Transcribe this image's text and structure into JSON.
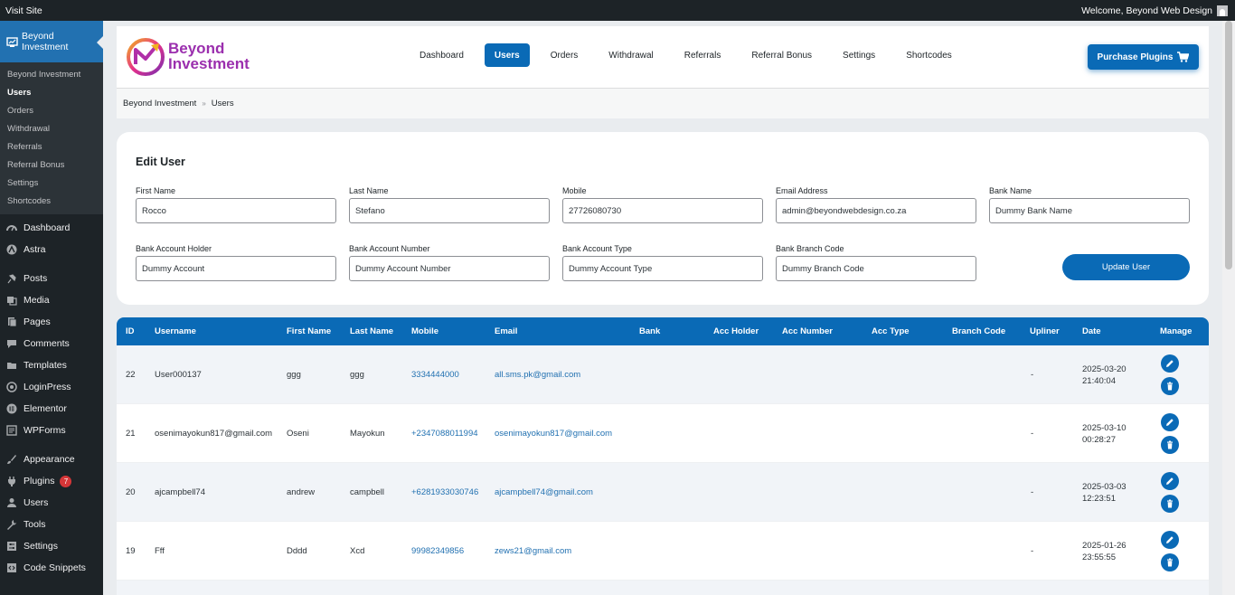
{
  "adminbar": {
    "visit_site": "Visit Site",
    "welcome": "Welcome, Beyond Web Design"
  },
  "sidebar": {
    "active_plugin": "Beyond Investment",
    "submenu": [
      "Beyond Investment",
      "Users",
      "Orders",
      "Withdrawal",
      "Referrals",
      "Referral Bonus",
      "Settings",
      "Shortcodes"
    ],
    "current_submenu": "Users",
    "menu": [
      {
        "label": "Dashboard",
        "icon": "dashboard-icon"
      },
      {
        "label": "Astra",
        "icon": "astra-icon"
      },
      {
        "label": "Posts",
        "icon": "pin-icon"
      },
      {
        "label": "Media",
        "icon": "media-icon"
      },
      {
        "label": "Pages",
        "icon": "pages-icon"
      },
      {
        "label": "Comments",
        "icon": "comment-icon"
      },
      {
        "label": "Templates",
        "icon": "folder-icon"
      },
      {
        "label": "LoginPress",
        "icon": "loginpress-icon"
      },
      {
        "label": "Elementor",
        "icon": "elementor-icon"
      },
      {
        "label": "WPForms",
        "icon": "wpforms-icon"
      },
      {
        "label": "Appearance",
        "icon": "brush-icon"
      },
      {
        "label": "Plugins",
        "icon": "plugin-icon",
        "badge": "7"
      },
      {
        "label": "Users",
        "icon": "user-icon"
      },
      {
        "label": "Tools",
        "icon": "wrench-icon"
      },
      {
        "label": "Settings",
        "icon": "settings-icon"
      },
      {
        "label": "Code Snippets",
        "icon": "code-icon"
      }
    ]
  },
  "header": {
    "logo_line1": "Beyond",
    "logo_line2": "Investment",
    "nav": [
      "Dashboard",
      "Users",
      "Orders",
      "Withdrawal",
      "Referrals",
      "Referral Bonus",
      "Settings",
      "Shortcodes"
    ],
    "active_nav": "Users",
    "purchase_label": "Purchase Plugins"
  },
  "breadcrumb": {
    "root": "Beyond Investment",
    "current": "Users"
  },
  "edit_user": {
    "title": "Edit User",
    "fields": [
      {
        "label": "First Name",
        "value": "Rocco"
      },
      {
        "label": "Last Name",
        "value": "Stefano"
      },
      {
        "label": "Mobile",
        "value": "27726080730"
      },
      {
        "label": "Email Address",
        "value": "admin@beyondwebdesign.co.za"
      },
      {
        "label": "Bank Name",
        "value": "Dummy Bank Name"
      },
      {
        "label": "Bank Account Holder",
        "value": "Dummy Account"
      },
      {
        "label": "Bank Account Number",
        "value": "Dummy Account Number"
      },
      {
        "label": "Bank Account Type",
        "value": "Dummy Account Type"
      },
      {
        "label": "Bank Branch Code",
        "value": "Dummy Branch Code"
      }
    ],
    "update_label": "Update User"
  },
  "table": {
    "headers": [
      "ID",
      "Username",
      "First Name",
      "Last Name",
      "Mobile",
      "Email",
      "Bank",
      "Acc Holder",
      "Acc Number",
      "Acc Type",
      "Branch Code",
      "Upliner",
      "Date",
      "Manage"
    ],
    "rows": [
      {
        "id": "22",
        "username": "User000137",
        "first": "ggg",
        "last": "ggg",
        "mobile": "3334444000",
        "email": "all.sms.pk@gmail.com",
        "upliner": "-",
        "date": "2025-03-20",
        "time": "21:40:04"
      },
      {
        "id": "21",
        "username": "osenimayokun817@gmail.com",
        "first": "Oseni",
        "last": "Mayokun",
        "mobile": "+2347088011994",
        "email": "osenimayokun817@gmail.com",
        "upliner": "-",
        "date": "2025-03-10",
        "time": "00:28:27"
      },
      {
        "id": "20",
        "username": "ajcampbell74",
        "first": "andrew",
        "last": "campbell",
        "mobile": "+6281933030746",
        "email": "ajcampbell74@gmail.com",
        "upliner": "-",
        "date": "2025-03-03",
        "time": "12:23:51"
      },
      {
        "id": "19",
        "username": "Fff",
        "first": "Dddd",
        "last": "Xcd",
        "mobile": "99982349856",
        "email": "zews21@gmail.com",
        "upliner": "-",
        "date": "2025-01-26",
        "time": "23:55:55"
      }
    ]
  },
  "colors": {
    "primary": "#0a6ab6",
    "wp_admin_dark": "#1d2327",
    "wp_active": "#2271b1",
    "logo_purple": "#9b2fae"
  }
}
